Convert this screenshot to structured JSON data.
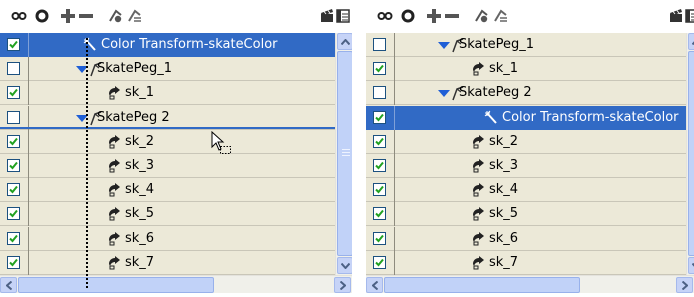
{
  "left_panel": {
    "rows": [
      {
        "label": "Color Transform-skateColor",
        "checked": true,
        "type": "transform",
        "selected": true
      },
      {
        "label": "SkatePeg_1",
        "checked": false,
        "type": "peg",
        "selected": false
      },
      {
        "label": "sk_1",
        "checked": true,
        "type": "drawing",
        "selected": false
      },
      {
        "label": "SkatePeg 2",
        "checked": false,
        "type": "peg",
        "selected": false
      },
      {
        "label": "sk_2",
        "checked": true,
        "type": "drawing",
        "selected": false
      },
      {
        "label": "sk_3",
        "checked": true,
        "type": "drawing",
        "selected": false
      },
      {
        "label": "sk_4",
        "checked": true,
        "type": "drawing",
        "selected": false
      },
      {
        "label": "sk_5",
        "checked": true,
        "type": "drawing",
        "selected": false
      },
      {
        "label": "sk_6",
        "checked": true,
        "type": "drawing",
        "selected": false
      },
      {
        "label": "sk_7",
        "checked": true,
        "type": "drawing",
        "selected": false
      }
    ]
  },
  "right_panel": {
    "rows": [
      {
        "label": "SkatePeg_1",
        "checked": false,
        "type": "peg",
        "selected": false
      },
      {
        "label": "sk_1",
        "checked": true,
        "type": "drawing",
        "selected": false
      },
      {
        "label": "SkatePeg 2",
        "checked": false,
        "type": "peg",
        "selected": false
      },
      {
        "label": "Color Transform-skateColor",
        "checked": true,
        "type": "transform",
        "selected": true
      },
      {
        "label": "sk_2",
        "checked": true,
        "type": "drawing",
        "selected": false
      },
      {
        "label": "sk_3",
        "checked": true,
        "type": "drawing",
        "selected": false
      },
      {
        "label": "sk_4",
        "checked": true,
        "type": "drawing",
        "selected": false
      },
      {
        "label": "sk_5",
        "checked": true,
        "type": "drawing",
        "selected": false
      },
      {
        "label": "sk_6",
        "checked": true,
        "type": "drawing",
        "selected": false
      },
      {
        "label": "sk_7",
        "checked": true,
        "type": "drawing",
        "selected": false
      }
    ]
  },
  "toolbar": {
    "buttons": [
      "link-icon",
      "circle-icon",
      "add-icon",
      "remove-icon",
      "add-peg-icon",
      "collapse-peg-icon",
      "clapper-icon",
      "menu-icon"
    ]
  },
  "colors": {
    "selection": "#316ac5",
    "row_bg": "#ece9d8",
    "check": "#21a121",
    "peg_triangle": "#1f5fd6"
  },
  "vertical_scroll_left": {
    "position": 0.0,
    "visible_fraction": 0.85
  },
  "vertical_scroll_right": {
    "position": 0.0,
    "visible_fraction": 0.85
  },
  "horizontal_scroll": {
    "position": 0.0,
    "visible_fraction": 0.5
  }
}
